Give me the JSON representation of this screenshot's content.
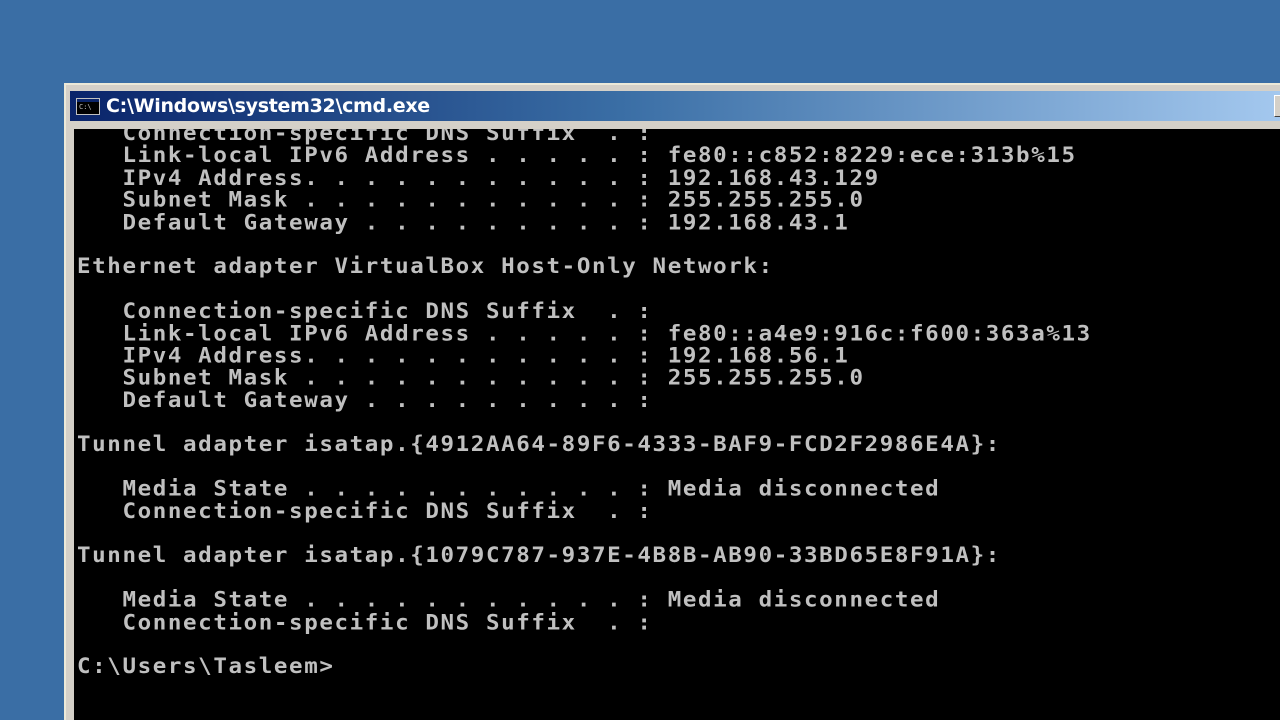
{
  "window": {
    "title": "C:\\Windows\\system32\\cmd.exe",
    "icon_text": "C:\\"
  },
  "console": {
    "lines": [
      "   Connection-specific DNS Suffix  . :",
      "   Link-local IPv6 Address . . . . . : fe80::c852:8229:ece:313b%15",
      "   IPv4 Address. . . . . . . . . . . : 192.168.43.129",
      "   Subnet Mask . . . . . . . . . . . : 255.255.255.0",
      "   Default Gateway . . . . . . . . . : 192.168.43.1",
      "",
      "Ethernet adapter VirtualBox Host-Only Network:",
      "",
      "   Connection-specific DNS Suffix  . :",
      "   Link-local IPv6 Address . . . . . : fe80::a4e9:916c:f600:363a%13",
      "   IPv4 Address. . . . . . . . . . . : 192.168.56.1",
      "   Subnet Mask . . . . . . . . . . . : 255.255.255.0",
      "   Default Gateway . . . . . . . . . :",
      "",
      "Tunnel adapter isatap.{4912AA64-89F6-4333-BAF9-FCD2F2986E4A}:",
      "",
      "   Media State . . . . . . . . . . . : Media disconnected",
      "   Connection-specific DNS Suffix  . :",
      "",
      "Tunnel adapter isatap.{1079C787-937E-4B8B-AB90-33BD65E8F91A}:",
      "",
      "   Media State . . . . . . . . . . . : Media disconnected",
      "   Connection-specific DNS Suffix  . :",
      "",
      "C:\\Users\\Tasleem>"
    ]
  },
  "colors": {
    "desktop": "#3a6ea5",
    "console_bg": "#000000",
    "console_text": "#c0c0c0",
    "title_text": "#ffffff"
  },
  "icons": {
    "title_icon": "cmd-icon",
    "window_button": "minimize-icon"
  }
}
